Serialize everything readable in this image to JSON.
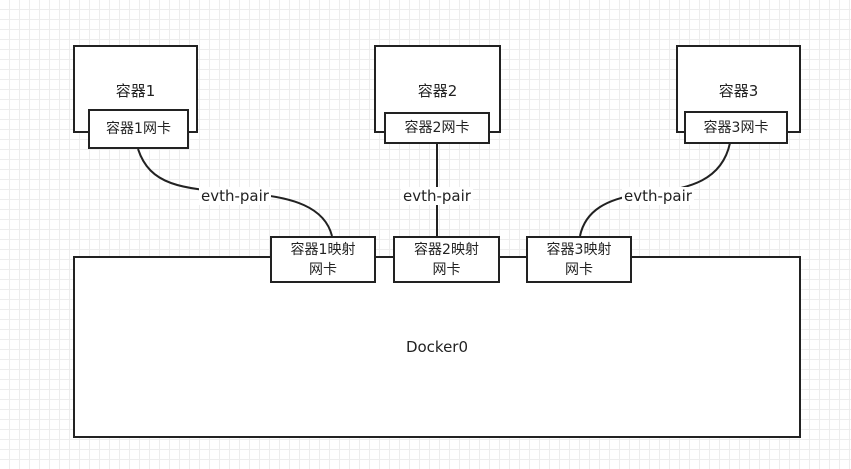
{
  "containers": [
    {
      "name": "容器1",
      "nic": "容器1网卡"
    },
    {
      "name": "容器2",
      "nic": "容器2网卡"
    },
    {
      "name": "容器3",
      "nic": "容器3网卡"
    }
  ],
  "mapped_nics": [
    {
      "line1": "容器1映射",
      "line2": "网卡"
    },
    {
      "line1": "容器2映射",
      "line2": "网卡"
    },
    {
      "line1": "容器3映射",
      "line2": "网卡"
    }
  ],
  "edge_labels": [
    "evth-pair",
    "evth-pair",
    "evth-pair"
  ],
  "bridge": {
    "name": "Docker0"
  }
}
